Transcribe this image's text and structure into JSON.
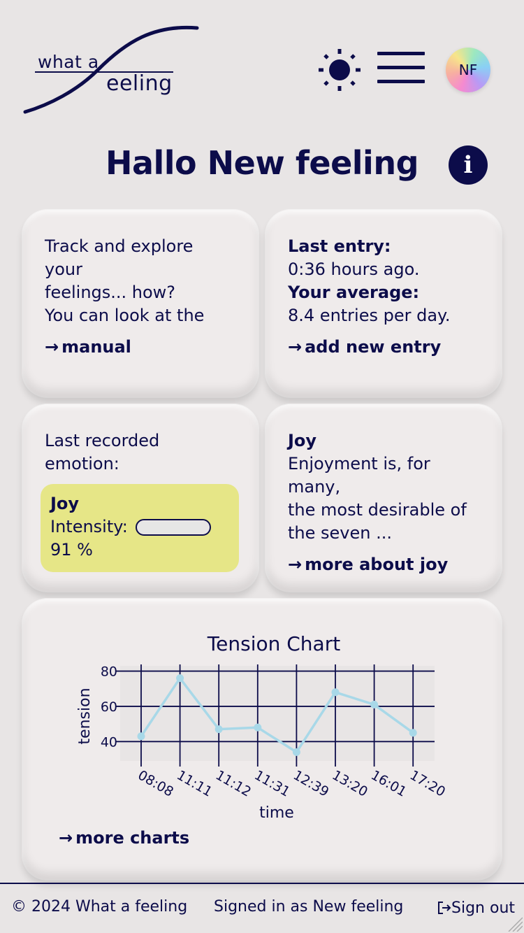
{
  "header": {
    "logo_line1": "what a",
    "logo_line2": "eeling",
    "theme_icon": "sun-icon",
    "menu_icon": "hamburger-menu-icon",
    "avatar_initials": "NF"
  },
  "greeting": "Hallo New feeling",
  "info_icon_label": "i",
  "intro_card": {
    "text_line1": "Track and explore your",
    "text_line2": "feelings... how?",
    "text_line3": "You can look at the",
    "link_arrow": "→",
    "link_label": "manual"
  },
  "stats_card": {
    "last_entry_label": "Last entry:",
    "last_entry_value": "0:36 hours ago.",
    "average_label": "Your average:",
    "average_value": "8.4 entries per day.",
    "link_arrow": "→",
    "link_label": "add new entry"
  },
  "emotion_card": {
    "heading": "Last recorded emotion:",
    "emotion": "Joy",
    "intensity_label": "Intensity:",
    "intensity_value": "91 %",
    "intensity_fraction": 0.91,
    "box_color": "#e6e687"
  },
  "joy_card": {
    "title": "Joy",
    "text_line1": "Enjoyment is, for many,",
    "text_line2": "the most desirable of",
    "text_line3": "the seven ...",
    "link_arrow": "→",
    "link_label": "more about joy"
  },
  "chart_card": {
    "link_arrow": "→",
    "link_label": "more charts"
  },
  "chart_data": {
    "type": "line",
    "title": "Tension Chart",
    "xlabel": "time",
    "ylabel": "tension",
    "x": [
      "08:08",
      "11:11",
      "11:12",
      "11:31",
      "12:39",
      "13:20",
      "16:01",
      "17:20"
    ],
    "series": [
      {
        "values": [
          43,
          76,
          47,
          48,
          34,
          68,
          61,
          45
        ]
      }
    ],
    "yticks": [
      40,
      60,
      80
    ],
    "ylim": [
      29,
      83
    ],
    "grid": true,
    "line_color": "#a8d8e8",
    "grid_color": "#0c0c4a"
  },
  "footer": {
    "copyright": "© 2024 What a feeling",
    "signed_in": "Signed in as New feeling",
    "signout_icon": "sign-out-icon",
    "signout_label": "Sign out"
  }
}
